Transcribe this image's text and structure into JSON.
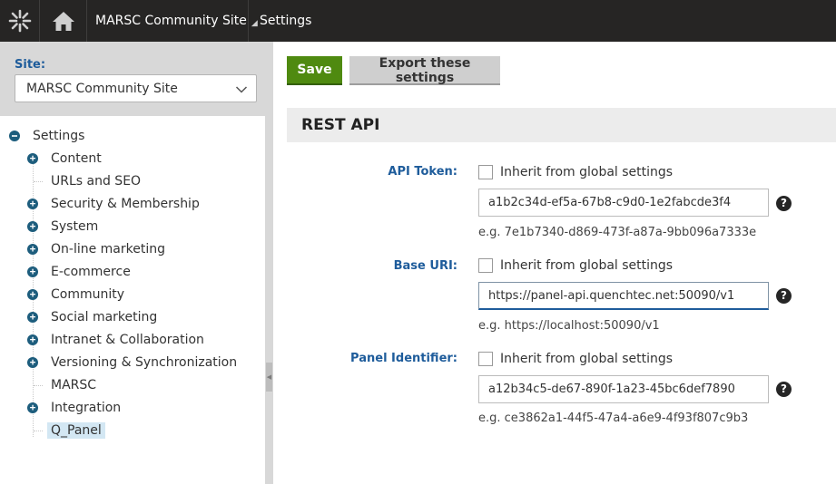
{
  "topbar": {
    "logo_icon": "kentico-logo-icon",
    "home_icon": "home-icon",
    "site_name": "MARSC Community Site",
    "app_name": "Settings"
  },
  "site_selector": {
    "label": "Site:",
    "value": "MARSC Community Site"
  },
  "tree": {
    "root": "Settings",
    "items": [
      {
        "label": "Content",
        "expandable": true
      },
      {
        "label": "URLs and SEO",
        "expandable": false
      },
      {
        "label": "Security & Membership",
        "expandable": true
      },
      {
        "label": "System",
        "expandable": true
      },
      {
        "label": "On-line marketing",
        "expandable": true
      },
      {
        "label": "E-commerce",
        "expandable": true
      },
      {
        "label": "Community",
        "expandable": true
      },
      {
        "label": "Social marketing",
        "expandable": true
      },
      {
        "label": "Intranet & Collaboration",
        "expandable": true
      },
      {
        "label": "Versioning & Synchronization",
        "expandable": true
      },
      {
        "label": "MARSC",
        "expandable": false
      },
      {
        "label": "Integration",
        "expandable": true
      },
      {
        "label": "Q_Panel",
        "expandable": false,
        "selected": true
      }
    ]
  },
  "toolbar": {
    "save_label": "Save",
    "export_label": "Export these settings"
  },
  "section": {
    "title": "REST API"
  },
  "fields": [
    {
      "label": "API Token:",
      "inherit_label": "Inherit from global settings",
      "value": "a1b2c34d-ef5a-67b8-c9d0-1e2fabcde3f4",
      "example": "e.g. 7e1b7340-d869-473f-a87a-9bb096a7333e"
    },
    {
      "label": "Base URI:",
      "inherit_label": "Inherit from global settings",
      "value": "https://panel-api.quenchtec.net:50090/v1",
      "example": "e.g. https://localhost:50090/v1"
    },
    {
      "label": "Panel Identifier:",
      "inherit_label": "Inherit from global settings",
      "value": "a12b34c5-de67-890f-1a23-45bc6def7890",
      "example": "e.g. ce3862a1-44f5-47a4-a6e9-4f93f807c9b3"
    }
  ],
  "colors": {
    "topbar_bg": "#262524",
    "accent_blue": "#1e5c9b",
    "save_green": "#4f8a10",
    "tree_toggle": "#1d5d7d",
    "selected_bg": "#d3e7f3"
  }
}
